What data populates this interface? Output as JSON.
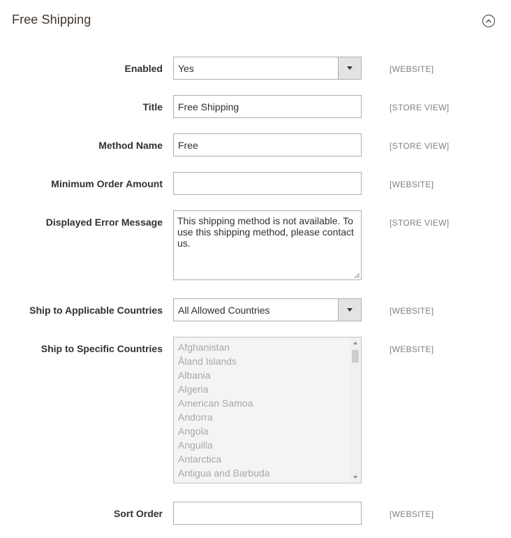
{
  "section": {
    "title": "Free Shipping"
  },
  "fields": {
    "enabled": {
      "label": "Enabled",
      "value": "Yes",
      "scope": "[WEBSITE]"
    },
    "title": {
      "label": "Title",
      "value": "Free Shipping",
      "scope": "[STORE VIEW]"
    },
    "method_name": {
      "label": "Method Name",
      "value": "Free",
      "scope": "[STORE VIEW]"
    },
    "min_order_amount": {
      "label": "Minimum Order Amount",
      "value": "",
      "scope": "[WEBSITE]"
    },
    "error_message": {
      "label": "Displayed Error Message",
      "value": "This shipping method is not available. To use this shipping method, please contact us.",
      "scope": "[STORE VIEW]"
    },
    "applicable_countries": {
      "label": "Ship to Applicable Countries",
      "value": "All Allowed Countries",
      "scope": "[WEBSITE]"
    },
    "specific_countries": {
      "label": "Ship to Specific Countries",
      "scope": "[WEBSITE]",
      "options": [
        "Afghanistan",
        "Åland Islands",
        "Albania",
        "Algeria",
        "American Samoa",
        "Andorra",
        "Angola",
        "Anguilla",
        "Antarctica",
        "Antigua and Barbuda"
      ]
    },
    "sort_order": {
      "label": "Sort Order",
      "value": "",
      "scope": "[WEBSITE]"
    }
  },
  "icons": {
    "collapse": "chevron-up-circle-icon",
    "dropdown": "triangle-down-icon"
  }
}
